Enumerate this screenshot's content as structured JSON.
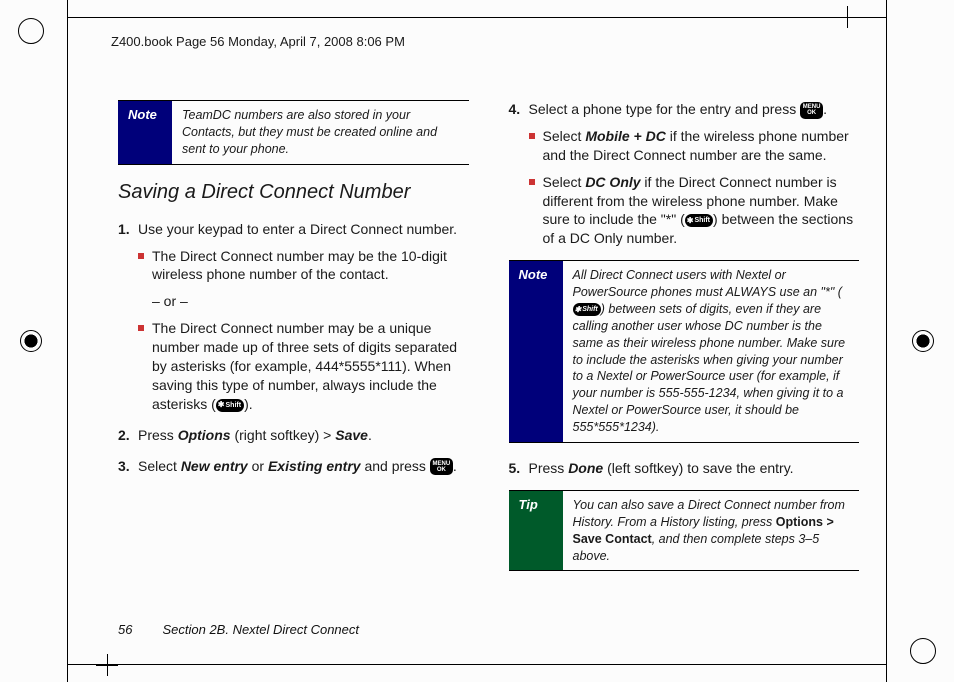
{
  "crop_header": "Z400.book  Page 56  Monday, April 7, 2008  8:06 PM",
  "note_label": "Note",
  "tip_label": "Tip",
  "note1_body": "TeamDC numbers are also stored in your Contacts, but they must be created online and sent to your phone.",
  "section_heading": "Saving a Direct Connect Number",
  "steps_left": {
    "s1": "Use your keypad to enter a Direct Connect number.",
    "s1_sub1": "The Direct Connect number may be the 10-digit wireless phone number of the contact.",
    "s1_or": "– or –",
    "s1_sub2_a": "The Direct Connect number may be a unique number made up of three sets of digits separated by asterisks (for example, 444*5555*111). When saving this type of number, always include the asterisks (",
    "s1_sub2_b": ").",
    "s2_a": "Press ",
    "s2_b_em": "Options",
    "s2_c": " (right softkey) > ",
    "s2_d_em": "Save",
    "s2_e": ".",
    "s3_a": "Select ",
    "s3_b_em": "New entry",
    "s3_c": " or ",
    "s3_d_em": "Existing entry",
    "s3_e": " and press ",
    "s3_f": "."
  },
  "steps_right": {
    "s4_a": "Select a phone type for the entry and press ",
    "s4_b": ".",
    "s4_sub1_a": "Select ",
    "s4_sub1_b_em": "Mobile + DC",
    "s4_sub1_c": " if the wireless phone number and the Direct Connect number are the same.",
    "s4_sub2_a": "Select ",
    "s4_sub2_b_em": "DC Only",
    "s4_sub2_c": " if the Direct Connect number is different from the wireless phone number. Make sure to include the \"*\" (",
    "s4_sub2_d": ") between the sections of a DC Only number.",
    "note2_body": "All Direct Connect users with Nextel or PowerSource phones must ALWAYS use an \"*\" (",
    "note2_body2": ") between sets of digits, even if they are calling another user whose DC number is the same as their wireless phone number. Make sure to include the asterisks when giving your number to a Nextel or PowerSource user (for example, if your number is 555-555-1234, when giving it to a Nextel or PowerSource user, it should be 555*555*1234).",
    "s5_a": "Press ",
    "s5_b_em": "Done",
    "s5_c": " (left softkey) to save the entry.",
    "tip_body_a": "You can also save a Direct Connect number from History. From a History listing, press ",
    "tip_body_b_strong": "Options > Save Contact",
    "tip_body_c": ", and then complete steps 3–5 above."
  },
  "key_menu_top": "MENU",
  "key_menu_bot": "OK",
  "key_shift": "Shift",
  "footer_page": "56",
  "footer_section": "Section 2B. Nextel Direct Connect"
}
